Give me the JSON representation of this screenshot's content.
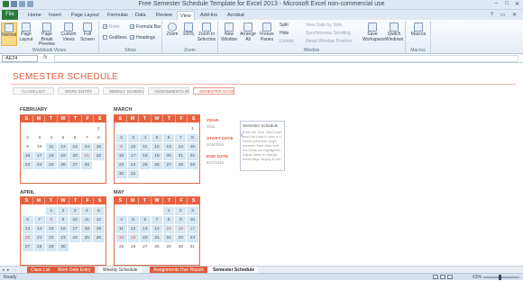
{
  "window": {
    "title": "Free Semester Schedule Template for Excel 2013 - Microsoft Excel non-commercial use",
    "controls": [
      "–",
      "□",
      "✕"
    ]
  },
  "ribbon_tabs": [
    "File",
    "Home",
    "Insert",
    "Page Layout",
    "Formulas",
    "Data",
    "Review",
    "View",
    "Add-Ins",
    "Acrobat"
  ],
  "active_tab": "View",
  "ribbon": {
    "workbook_views": {
      "label": "Workbook Views",
      "buttons": [
        "Normal",
        "Page Layout",
        "Page Break Preview",
        "Custom Views",
        "Full Screen"
      ]
    },
    "show": {
      "label": "Show",
      "checks": [
        {
          "label": "Ruler",
          "checked": true,
          "dim": true
        },
        {
          "label": "Formula Bar",
          "checked": true
        },
        {
          "label": "Gridlines",
          "checked": false
        },
        {
          "label": "Headings",
          "checked": true
        }
      ]
    },
    "zoom": {
      "label": "Zoom",
      "buttons": [
        "Zoom",
        "100%",
        "Zoom to Selection"
      ]
    },
    "window": {
      "label": "Window",
      "buttons": [
        "New Window",
        "Arrange All",
        "Freeze Panes"
      ],
      "small": [
        "Split",
        "Hide",
        "Unhide",
        "View Side by Side",
        "Synchronous Scrolling",
        "Reset Window Position"
      ],
      "big": [
        "Save Workspace",
        "Switch Windows"
      ]
    },
    "macros": {
      "label": "Macros",
      "buttons": [
        "Macros"
      ]
    }
  },
  "formula_bar": {
    "name_box": "AE24",
    "fx": "fx",
    "value": ""
  },
  "sheet": {
    "title": "SEMESTER SCHEDULE",
    "nav_tabs": [
      "CLASS LIST",
      "WORK ENTRY",
      "WEEKLY SCHEDULE",
      "ASSIGNMENTS DUE",
      "SEMESTER SCHEDULE"
    ],
    "active_nav": 4,
    "day_headers": [
      "S",
      "M",
      "T",
      "W",
      "T",
      "F",
      "S"
    ],
    "months": [
      {
        "name": "FEBRUARY",
        "cells": [
          "",
          "",
          "",
          "",
          "",
          "",
          "1",
          "2",
          "3",
          "4",
          "5",
          "6",
          "7",
          "8",
          "9",
          "10",
          "11",
          "12",
          "13",
          "14",
          "15",
          "16",
          "17",
          "18",
          "19",
          "20",
          "21",
          "22",
          "23",
          "24",
          "25",
          "26",
          "27",
          "28",
          "",
          "",
          "",
          "",
          "",
          "",
          "",
          ""
        ],
        "highlight_from": 16,
        "highlight_to": 34,
        "red": [
          26
        ]
      },
      {
        "name": "MARCH",
        "cells": [
          "",
          "",
          "",
          "",
          "",
          "",
          "1",
          "2",
          "3",
          "4",
          "5",
          "6",
          "7",
          "8",
          "9",
          "10",
          "11",
          "12",
          "13",
          "14",
          "15",
          "16",
          "17",
          "18",
          "19",
          "20",
          "21",
          "22",
          "23",
          "24",
          "25",
          "26",
          "27",
          "28",
          "29",
          "30",
          "31",
          "",
          "",
          "",
          "",
          ""
        ],
        "highlight_from": 7,
        "highlight_to": 37,
        "red": [
          14
        ]
      },
      {
        "name": "APRIL",
        "cells": [
          "",
          "",
          "1",
          "2",
          "3",
          "4",
          "5",
          "6",
          "7",
          "8",
          "9",
          "10",
          "11",
          "12",
          "13",
          "14",
          "15",
          "16",
          "17",
          "18",
          "19",
          "20",
          "21",
          "22",
          "23",
          "24",
          "25",
          "26",
          "27",
          "28",
          "29",
          "30",
          "",
          "",
          "",
          "",
          "",
          "",
          "",
          "",
          "",
          ""
        ],
        "highlight_from": 2,
        "highlight_to": 32,
        "red": [
          9,
          21
        ]
      },
      {
        "name": "MAY",
        "cells": [
          "",
          "",
          "",
          "",
          "1",
          "2",
          "3",
          "4",
          "5",
          "6",
          "7",
          "8",
          "9",
          "10",
          "11",
          "12",
          "13",
          "14",
          "15",
          "16",
          "17",
          "18",
          "19",
          "20",
          "21",
          "22",
          "23",
          "24",
          "25",
          "26",
          "27",
          "28",
          "29",
          "30",
          "31",
          "",
          "",
          "",
          "",
          "",
          "",
          ""
        ],
        "highlight_from": 4,
        "highlight_to": 28,
        "red": [
          18,
          19,
          20,
          21,
          22
        ]
      }
    ],
    "info": [
      {
        "label": "YEAR",
        "value": "2015"
      },
      {
        "label": "START DATE",
        "value": "2/16/2015"
      },
      {
        "label": "END DATE",
        "value": "5/27/2015"
      }
    ],
    "note": {
      "title": "Semester Schedule",
      "body": "Enter the Year, Start Date and End Date to view a 4-month schedule. Days between Start Date and End Date are highlighted. Adjust dates to change which days display in red."
    }
  },
  "sheet_tabs": [
    {
      "label": "Class List",
      "style": "red"
    },
    {
      "label": "Work Date Entry",
      "style": "red"
    },
    {
      "label": "Weekly Schedule",
      "style": "white"
    },
    {
      "label": "Assignments Due Report",
      "style": "red"
    },
    {
      "label": "Semester Schedule",
      "style": "active"
    }
  ],
  "status": {
    "ready": "Ready",
    "zoom": "63%",
    "zoom_fraction": 0.45
  },
  "colors": {
    "accent": "#e05a3a",
    "highlight": "#d5e7f3",
    "excel_green": "#2c7a3a"
  }
}
